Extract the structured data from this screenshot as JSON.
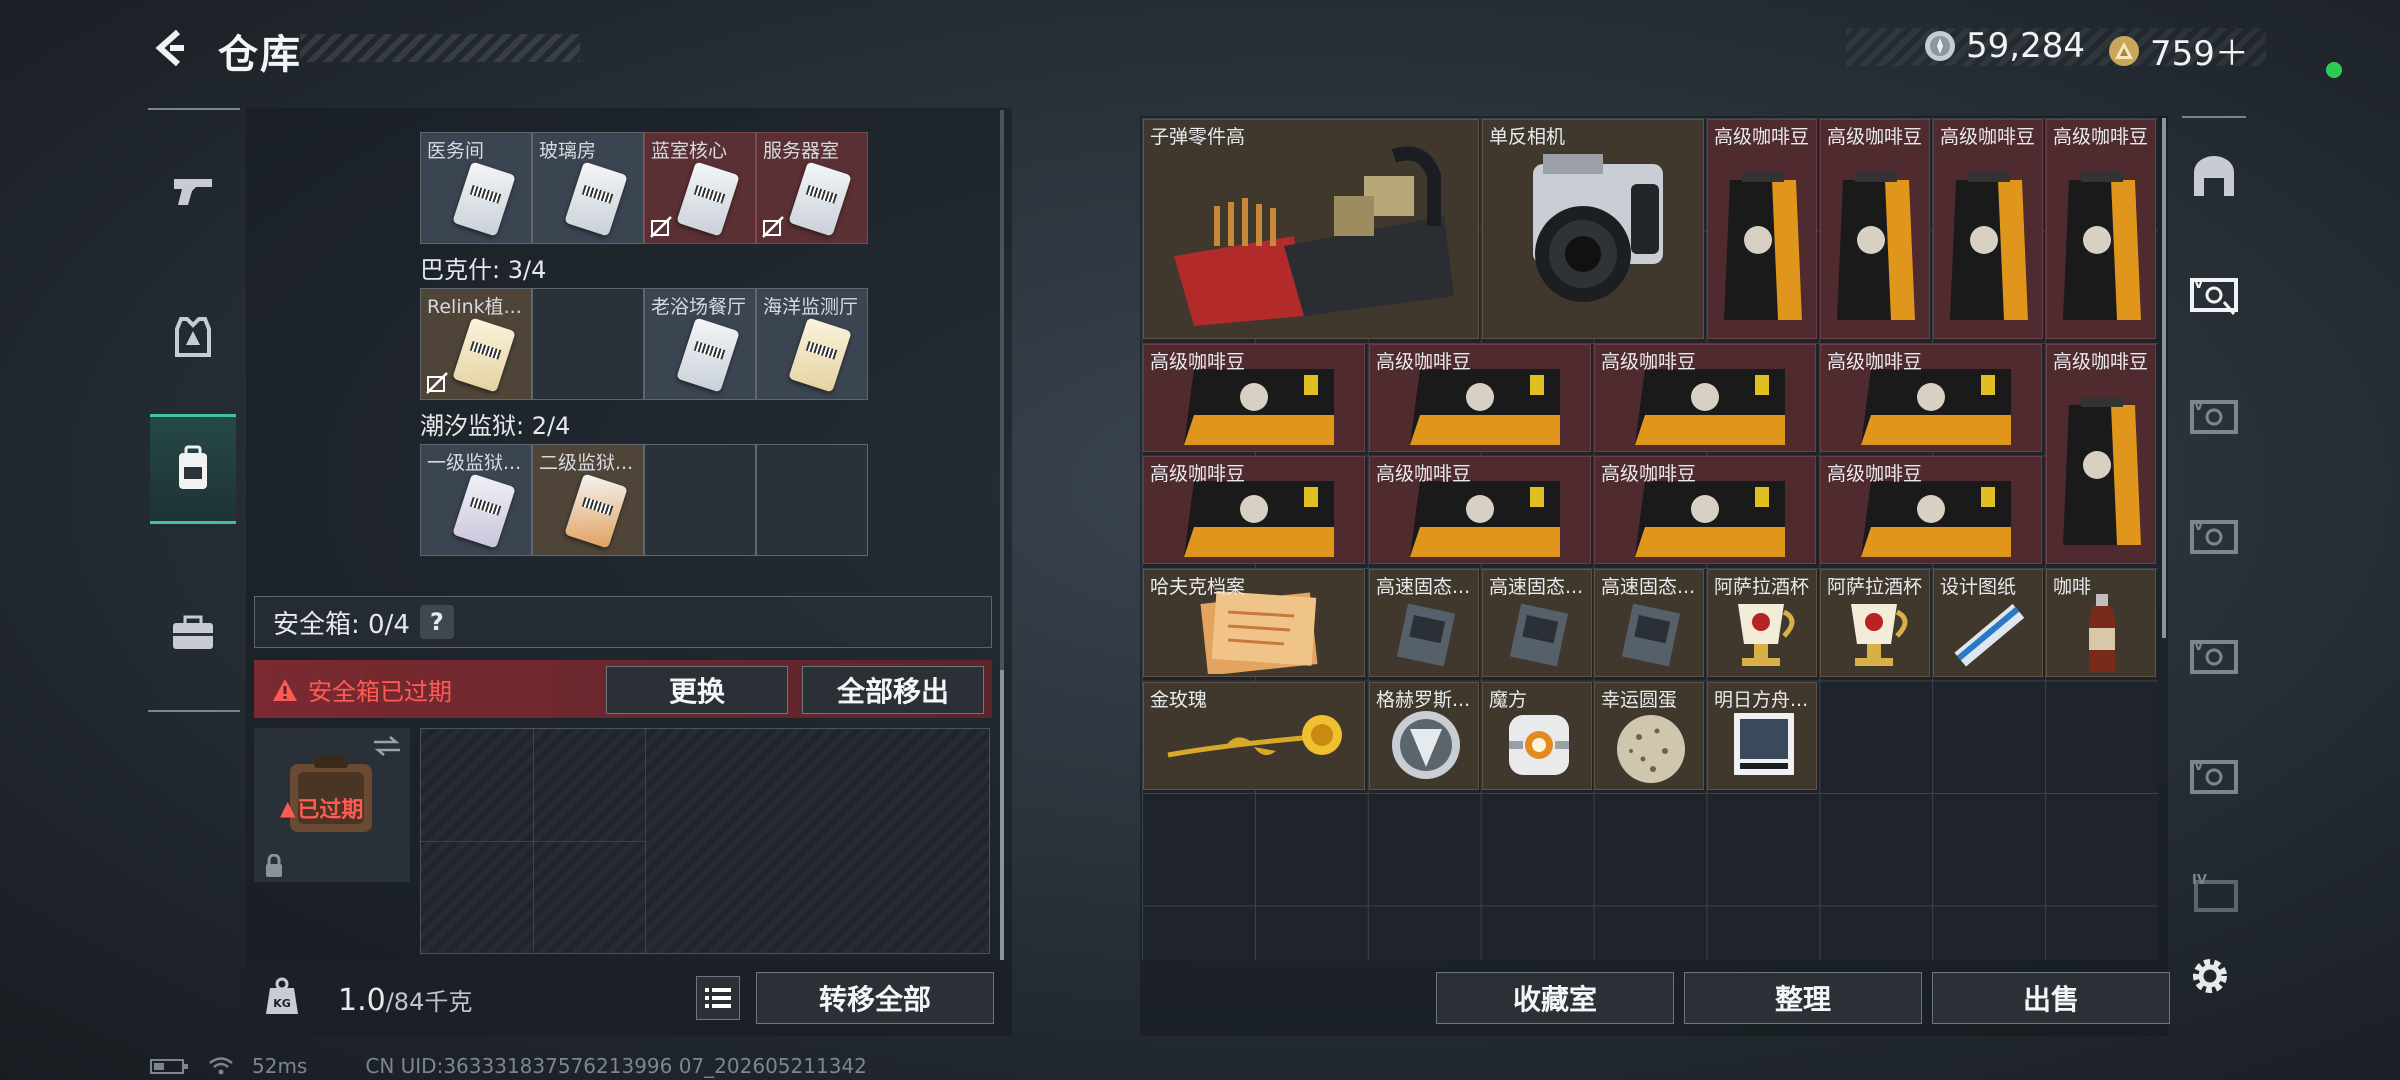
{
  "header": {
    "title": "仓库",
    "currency_a": "59,284",
    "currency_b": "759＋"
  },
  "left_tabs": [
    "weapons-tab",
    "gear-tab",
    "backpack-tab",
    "case-tab"
  ],
  "keycards": {
    "row1": [
      {
        "label": "医务间",
        "style": "blue"
      },
      {
        "label": "玻璃房",
        "style": "blue"
      },
      {
        "label": "蓝室核心",
        "style": "red"
      },
      {
        "label": "服务器室",
        "style": "red"
      }
    ],
    "group2_title": "巴克什: 3/4",
    "row2": [
      {
        "label": "Relink植...",
        "style": "tan"
      },
      {
        "label": "",
        "style": "empty"
      },
      {
        "label": "老浴场餐厅",
        "style": "blue"
      },
      {
        "label": "海洋监测厅",
        "style": "blue"
      }
    ],
    "group3_title": "潮汐监狱: 2/4",
    "row3": [
      {
        "label": "一级监狱...",
        "style": "blue"
      },
      {
        "label": "二级监狱...",
        "style": "tan"
      },
      {
        "label": "",
        "style": "empty"
      },
      {
        "label": "",
        "style": "empty"
      }
    ]
  },
  "safe": {
    "label": "安全箱: 0/4",
    "help": "?",
    "expired_warning": "安全箱已过期",
    "replace_button": "更换",
    "move_all_out_button": "全部移出",
    "box_status": "已过期"
  },
  "weight": {
    "current": "1.0",
    "max": "/84千克",
    "transfer_all_button": "转移全部"
  },
  "stash_items": {
    "bullet_parts": "子弹零件高",
    "camera": "单反相机",
    "coffee": "高级咖啡豆",
    "hafk_file": "哈夫克档案",
    "ssd": "高速固态...",
    "azalea_cup": "阿萨拉酒杯",
    "design_drawing": "设计图纸",
    "coffee_drink": "咖啡",
    "golden_rose": "金玫瑰",
    "grex_emblem": "格赫罗斯...",
    "cube": "魔方",
    "lucky_egg": "幸运圆蛋",
    "ost": "明日方舟..."
  },
  "bottom_buttons": {
    "collection": "收藏室",
    "organize": "整理",
    "sell": "出售"
  },
  "footer": {
    "ping": "52ms",
    "uid": "CN UID:363331837576213996 07_202605211342"
  },
  "colors": {
    "accent_green": "#3ec2a0",
    "warning_red": "#ff5b55",
    "online_dot": "#2ecc55"
  }
}
